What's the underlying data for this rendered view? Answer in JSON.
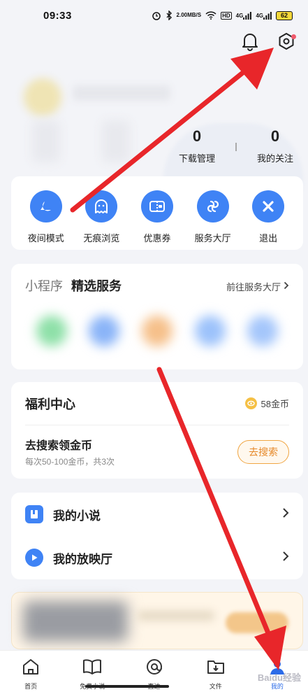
{
  "status_bar": {
    "time": "09:33",
    "net_speed": "2.00",
    "net_unit": "MB/S",
    "hd": "HD",
    "signal1": "4G",
    "signal2": "4G",
    "battery": "62"
  },
  "header": {
    "notification_icon": "bell-icon",
    "settings_icon": "settings-hexagon-icon"
  },
  "profile": {
    "stats": [
      {
        "value": "0",
        "label": "下载管理"
      },
      {
        "value": "0",
        "label": "我的关注"
      }
    ]
  },
  "shortcuts": [
    {
      "label": "夜间模式",
      "icon": "night-mode-icon"
    },
    {
      "label": "无痕浏览",
      "icon": "ghost-icon"
    },
    {
      "label": "优惠券",
      "icon": "coupon-icon"
    },
    {
      "label": "服务大厅",
      "icon": "service-hall-icon"
    },
    {
      "label": "退出",
      "icon": "close-icon"
    }
  ],
  "mini_programs": {
    "title1": "小程序",
    "title2": "精选服务",
    "link": "前往服务大厅",
    "blob_colors": [
      "#8ee0a8",
      "#8ab4f8",
      "#f6c08a",
      "#9cc2fb",
      "#a4c6fb"
    ]
  },
  "welfare": {
    "title": "福利中心",
    "coins": "58金币",
    "task_title": "去搜索领金币",
    "task_subtitle": "每次50-100金币，共3次",
    "task_button": "去搜索"
  },
  "links": [
    {
      "label": "我的小说",
      "icon": "book-icon"
    },
    {
      "label": "我的放映厅",
      "icon": "play-icon"
    }
  ],
  "tabbar": [
    {
      "label": "首页",
      "icon": "home-icon",
      "active": false
    },
    {
      "label": "免费小说",
      "icon": "open-book-icon",
      "active": false
    },
    {
      "label": "直达",
      "icon": "direct-icon",
      "active": false
    },
    {
      "label": "文件",
      "icon": "folder-icon",
      "active": false
    },
    {
      "label": "我的",
      "icon": "profile-icon",
      "active": true
    }
  ],
  "watermark": "Baidu经验",
  "colors": {
    "accent": "#3f83f5",
    "arrow": "#e8262a",
    "orange": "#e6892a"
  }
}
